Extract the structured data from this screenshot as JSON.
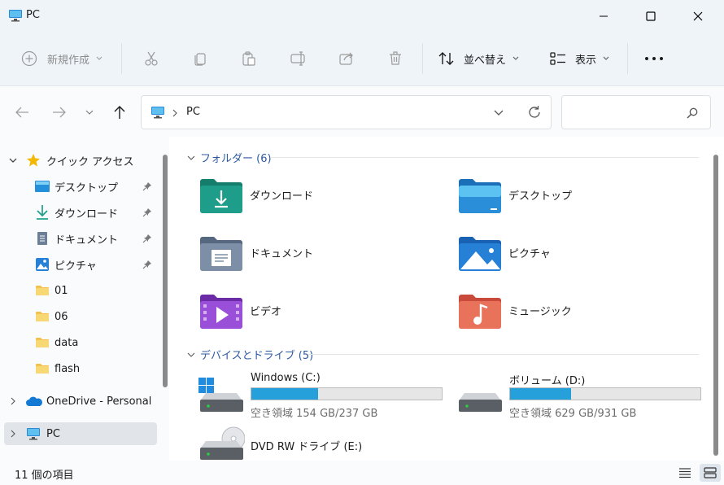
{
  "window": {
    "title": "PC"
  },
  "toolbar": {
    "new_label": "新規作成",
    "sort_label": "並べ替え",
    "view_label": "表示"
  },
  "address": {
    "location": "PC",
    "search_placeholder": ""
  },
  "sidebar": {
    "quick_access": "クイック アクセス",
    "items": [
      {
        "label": "デスクトップ",
        "icon": "desktop-icon",
        "pinned": true
      },
      {
        "label": "ダウンロード",
        "icon": "download-icon",
        "pinned": true
      },
      {
        "label": "ドキュメント",
        "icon": "document-icon",
        "pinned": true
      },
      {
        "label": "ピクチャ",
        "icon": "picture-icon",
        "pinned": true
      },
      {
        "label": "01",
        "icon": "folder-icon",
        "pinned": false
      },
      {
        "label": "06",
        "icon": "folder-icon",
        "pinned": false
      },
      {
        "label": "data",
        "icon": "folder-icon",
        "pinned": false
      },
      {
        "label": "flash",
        "icon": "folder-icon",
        "pinned": false
      }
    ],
    "onedrive": "OneDrive - Personal",
    "pc": "PC"
  },
  "main": {
    "folders_header": "フォルダー (6)",
    "folders": [
      {
        "label": "ダウンロード",
        "icon": "downloads-folder-icon",
        "color": "#1e9e8a"
      },
      {
        "label": "デスクトップ",
        "icon": "desktop-folder-icon",
        "color": "#2a8fd8"
      },
      {
        "label": "ドキュメント",
        "icon": "documents-folder-icon",
        "color": "#6b7f96"
      },
      {
        "label": "ピクチャ",
        "icon": "pictures-folder-icon",
        "color": "#2680d6"
      },
      {
        "label": "ビデオ",
        "icon": "videos-folder-icon",
        "color": "#8a3fc9"
      },
      {
        "label": "ミュージック",
        "icon": "music-folder-icon",
        "color": "#e0674a"
      }
    ],
    "drives_header": "デバイスとドライブ (5)",
    "drives": [
      {
        "name": "Windows (C:)",
        "free": "空き領域 154 GB/237 GB",
        "used_fraction": 0.35,
        "icon": "windows-drive-icon"
      },
      {
        "name": "ボリューム (D:)",
        "free": "空き領域 629 GB/931 GB",
        "used_fraction": 0.32,
        "icon": "hard-drive-icon"
      },
      {
        "name": "DVD RW ドライブ (E:)",
        "free": "",
        "icon": "dvd-drive-icon"
      }
    ]
  },
  "status": {
    "item_count": "11 個の項目"
  },
  "colors": {
    "accent": "#26a0da",
    "header_blue": "#2c5aa0",
    "star": "#f5b800"
  }
}
